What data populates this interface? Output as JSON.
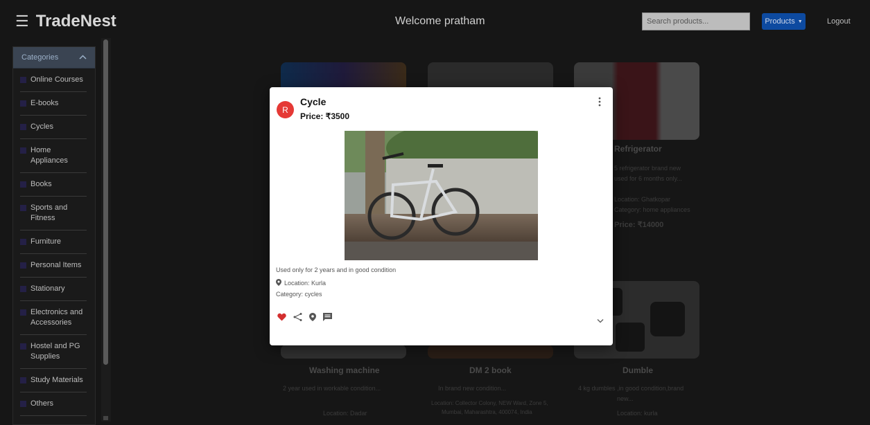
{
  "header": {
    "menu_icon": "hamburger-icon",
    "brand": "TradeNest",
    "welcome": "Welcome pratham",
    "search_placeholder": "Search products...",
    "products_label": "Products",
    "logout_label": "Logout",
    "accent": "#0d4aa0"
  },
  "sidebar": {
    "title": "Categories",
    "items": [
      {
        "label": "Online Courses"
      },
      {
        "label": "E-books"
      },
      {
        "label": "Cycles"
      },
      {
        "label": "Home Appliances"
      },
      {
        "label": "Books"
      },
      {
        "label": "Sports and Fitness"
      },
      {
        "label": "Furniture"
      },
      {
        "label": "Personal Items"
      },
      {
        "label": "Stationary"
      },
      {
        "label": "Electronics and Accessories"
      },
      {
        "label": "Hostel and PG Supplies"
      },
      {
        "label": "Study Materials"
      },
      {
        "label": "Others"
      }
    ]
  },
  "background_cards": [
    {
      "title": "Refrigerator",
      "line1": "5 refrigerator brand new",
      "line2": "used for 6 months only...",
      "line3": "Location: Ghatkopar",
      "line4": "Category: home appliances",
      "price": "Price: ₹14000"
    },
    {
      "title": "Washing machine",
      "line1": "2 year used in workable condition...",
      "line2": "",
      "line3": "Location: Dadar",
      "line4": "",
      "price": ""
    },
    {
      "title": "DM 2 book",
      "line1": "In brand new condition...",
      "line2": "Location: Collector Colony, NEW Ward, Zone 5,",
      "line3": "Mumbai, Maharashtra, 400074, India",
      "line4": "",
      "price": ""
    },
    {
      "title": "Dumble",
      "line1": "4 kg dumbles ,in good condition,brand",
      "line2": "new...",
      "line3": "Location: kurla",
      "line4": "",
      "price": ""
    }
  ],
  "modal": {
    "avatar_letter": "R",
    "title": "Cycle",
    "price": "Price: ₹3500",
    "description": "Used only for 2 years and in good condition",
    "location": "Location: Kurla",
    "category": "Category: cycles",
    "favorite_color": "#d32f2f",
    "icons": [
      "heart-icon",
      "share-icon",
      "location-pin-icon",
      "chat-icon",
      "chevron-down-icon",
      "more-vert-icon"
    ]
  }
}
